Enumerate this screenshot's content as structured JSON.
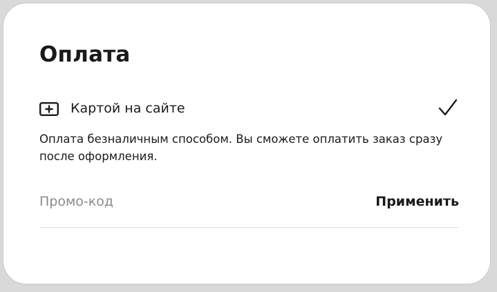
{
  "payment": {
    "title": "Оплата",
    "method": {
      "label": "Картой на сайте",
      "icon": "card-plus-icon",
      "selected": true,
      "selected_icon": "checkmark-icon"
    },
    "description": "Оплата безналичным способом. Вы сможете оплатить заказ сразу после оформления.",
    "promo": {
      "value": "",
      "placeholder": "Промо-код",
      "apply_label": "Применить"
    }
  },
  "colors": {
    "text": "#1a1a1a",
    "placeholder": "#8a8a8a",
    "divider": "#dedede",
    "card_background": "#ffffff",
    "page_background": "#d9d9d9"
  }
}
